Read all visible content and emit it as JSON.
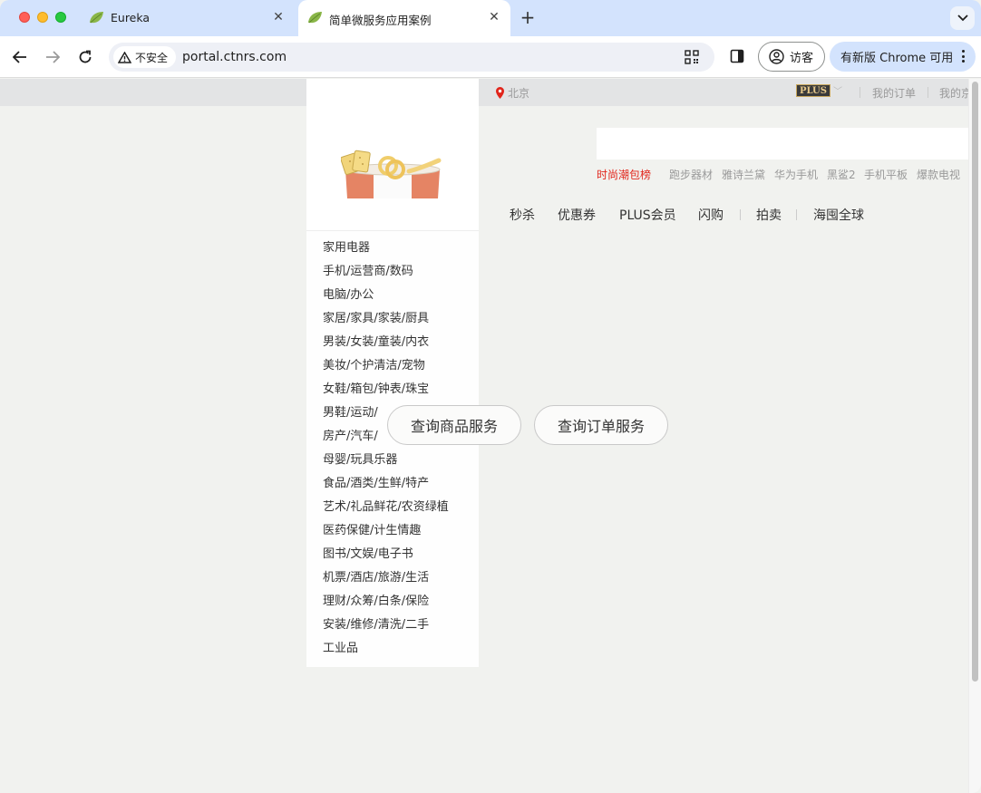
{
  "browser": {
    "tabs": [
      {
        "title": "Eureka",
        "icon": "spring-leaf-icon",
        "active": false
      },
      {
        "title": "简单微服务应用案例",
        "icon": "spring-leaf-icon",
        "active": true
      }
    ],
    "security_label": "不安全",
    "url": "portal.ctnrs.com",
    "profile_label": "访客",
    "update_label": "有新版 Chrome 可用"
  },
  "page": {
    "topbar": {
      "location": "北京",
      "plus_badge": "PLUS",
      "links": [
        "我的订单",
        "我的京"
      ]
    },
    "hot_search": [
      "时尚潮包榜",
      "跑步器材",
      "雅诗兰黛",
      "华为手机",
      "黑鲨2",
      "手机平板",
      "爆款电视"
    ],
    "main_nav": [
      "秒杀",
      "优惠券",
      "PLUS会员",
      "闪购",
      "拍卖",
      "海囤全球"
    ],
    "categories": [
      "家用电器",
      "手机/运营商/数码",
      "电脑/办公",
      "家居/家具/家装/厨具",
      "男装/女装/童装/内衣",
      "美妆/个护清洁/宠物",
      "女鞋/箱包/钟表/珠宝",
      "男鞋/运动/",
      "房产/汽车/",
      "母婴/玩具乐器",
      "食品/酒类/生鲜/特产",
      "艺术/礼品鲜花/农资绿植",
      "医药保健/计生情趣",
      "图书/文娱/电子书",
      "机票/酒店/旅游/生活",
      "理财/众筹/白条/保险",
      "安装/维修/清洗/二手",
      "工业品"
    ],
    "service_buttons": {
      "product": "查询商品服务",
      "order": "查询订单服务"
    }
  },
  "colors": {
    "tabbar_bg": "#d3e3fd",
    "hot_red": "#e1251b",
    "page_bg": "#f1f2ef"
  }
}
